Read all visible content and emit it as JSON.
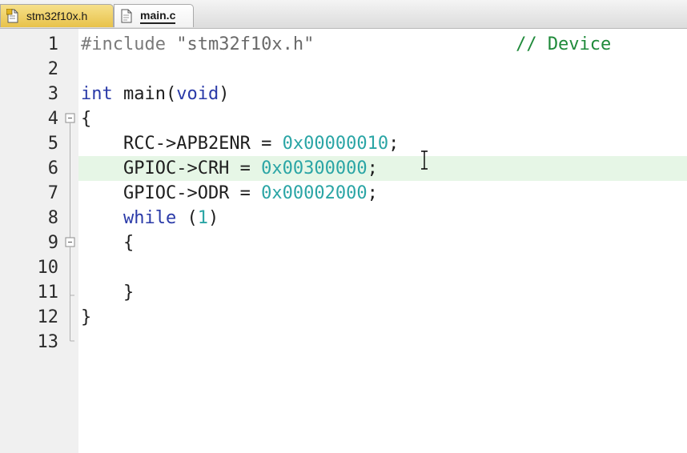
{
  "tabs": [
    {
      "label": "stm32f10x.h",
      "active": false
    },
    {
      "label": "main.c",
      "active": true
    }
  ],
  "lines": [
    {
      "n": "1",
      "tokens": [
        {
          "t": "#include",
          "c": "pp"
        },
        {
          "t": " ",
          "c": ""
        },
        {
          "t": "\"stm32f10x.h\"",
          "c": "str"
        },
        {
          "t": "                   ",
          "c": ""
        },
        {
          "t": "// Device",
          "c": "cmt"
        }
      ]
    },
    {
      "n": "2",
      "tokens": []
    },
    {
      "n": "3",
      "tokens": [
        {
          "t": "int",
          "c": "kw"
        },
        {
          "t": " main(",
          "c": ""
        },
        {
          "t": "void",
          "c": "kw"
        },
        {
          "t": ")",
          "c": ""
        }
      ]
    },
    {
      "n": "4",
      "tokens": [
        {
          "t": "{",
          "c": ""
        }
      ]
    },
    {
      "n": "5",
      "tokens": [
        {
          "t": "    RCC->APB2ENR = ",
          "c": ""
        },
        {
          "t": "0x00000010",
          "c": "num"
        },
        {
          "t": ";",
          "c": ""
        }
      ]
    },
    {
      "n": "6",
      "tokens": [
        {
          "t": "    GPIOC->CRH = ",
          "c": ""
        },
        {
          "t": "0x00300000",
          "c": "num"
        },
        {
          "t": ";",
          "c": ""
        }
      ]
    },
    {
      "n": "7",
      "tokens": [
        {
          "t": "    GPIOC->ODR = ",
          "c": ""
        },
        {
          "t": "0x00002000",
          "c": "num"
        },
        {
          "t": ";",
          "c": ""
        }
      ]
    },
    {
      "n": "8",
      "tokens": [
        {
          "t": "    ",
          "c": ""
        },
        {
          "t": "while",
          "c": "kw"
        },
        {
          "t": " (",
          "c": ""
        },
        {
          "t": "1",
          "c": "num"
        },
        {
          "t": ")",
          "c": ""
        }
      ]
    },
    {
      "n": "9",
      "tokens": [
        {
          "t": "    {",
          "c": ""
        }
      ]
    },
    {
      "n": "10",
      "tokens": []
    },
    {
      "n": "11",
      "tokens": [
        {
          "t": "    }",
          "c": ""
        }
      ]
    },
    {
      "n": "12",
      "tokens": [
        {
          "t": "}",
          "c": ""
        }
      ]
    },
    {
      "n": "13",
      "tokens": []
    }
  ],
  "current_line": 6,
  "colors": {
    "keyword": "#2a3aa8",
    "number": "#2aa5a5",
    "comment": "#1f8a3a",
    "preprocessor": "#7a7a7a",
    "current_line_bg": "#e6f6e6"
  }
}
